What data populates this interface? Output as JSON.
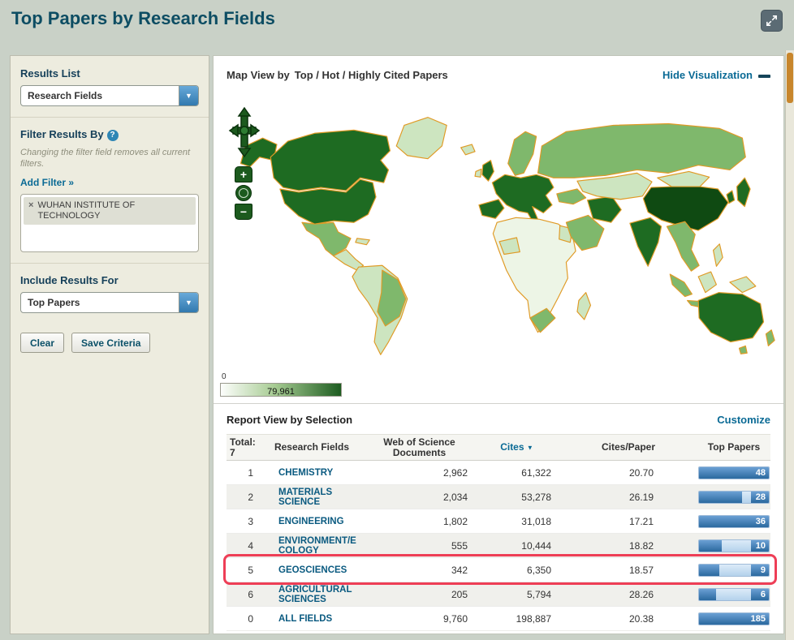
{
  "colors": {
    "accent_blue": "#0a6a95",
    "title_teal": "#0d4d63",
    "highlight_red": "#ee3e56",
    "map_border_orange": "#e09a25",
    "map_greens": [
      "#edf5e6",
      "#cde5c0",
      "#7fb86c",
      "#1e6b22",
      "#0f4a12"
    ],
    "bar_fill_blue": "#2b699f",
    "bar_track_blue": "#b4d2ec",
    "scroll_thumb_orange": "#c8862c"
  },
  "header": {
    "title": "Top Papers by Research Fields"
  },
  "sidebar": {
    "results_list_heading": "Results List",
    "results_list_value": "Research Fields",
    "filter_heading": "Filter Results By",
    "filter_help": "?",
    "filter_note": "Changing the filter field removes all current filters.",
    "add_filter": "Add Filter »",
    "filter_chip_remove": "×",
    "filter_chip_label": "WUHAN INSTITUTE OF TECHNOLOGY",
    "include_heading": "Include Results For",
    "include_value": "Top Papers",
    "clear_button": "Clear",
    "save_button": "Save Criteria"
  },
  "map": {
    "title": "Map View by",
    "title_detail": "Top / Hot / Highly Cited Papers",
    "hide_link": "Hide Visualization",
    "legend_min": "0",
    "legend_max": "79,961",
    "zoom_in": "+",
    "zoom_out": "−"
  },
  "report": {
    "heading": "Report View by Selection",
    "customize": "Customize",
    "total_label": "Total:",
    "total_value": "7",
    "columns": {
      "field": "Research Fields",
      "docs": "Web of Science Documents",
      "cites": "Cites",
      "cites_sort_icon": "▼",
      "cites_per_paper": "Cites/Paper",
      "top_papers": "Top Papers"
    },
    "rows": [
      {
        "rank": "1",
        "field": "CHEMISTRY",
        "docs": "2,962",
        "cites": "61,322",
        "cites_per_paper": "20.70",
        "top_papers": "48",
        "bar_pct": 95
      },
      {
        "rank": "2",
        "field": "MATERIALS\nSCIENCE",
        "docs": "2,034",
        "cites": "53,278",
        "cites_per_paper": "26.19",
        "top_papers": "28",
        "bar_pct": 62
      },
      {
        "rank": "3",
        "field": "ENGINEERING",
        "docs": "1,802",
        "cites": "31,018",
        "cites_per_paper": "17.21",
        "top_papers": "36",
        "bar_pct": 78
      },
      {
        "rank": "4",
        "field": "ENVIRONMENT/E\nCOLOGY",
        "docs": "555",
        "cites": "10,444",
        "cites_per_paper": "18.82",
        "top_papers": "10",
        "bar_pct": 32
      },
      {
        "rank": "5",
        "field": "GEOSCIENCES",
        "docs": "342",
        "cites": "6,350",
        "cites_per_paper": "18.57",
        "top_papers": "9",
        "bar_pct": 29,
        "highlighted": true
      },
      {
        "rank": "6",
        "field": "AGRICULTURAL\nSCIENCES",
        "docs": "205",
        "cites": "5,794",
        "cites_per_paper": "28.26",
        "top_papers": "6",
        "bar_pct": 24
      },
      {
        "rank": "0",
        "field": "ALL FIELDS",
        "docs": "9,760",
        "cites": "198,887",
        "cites_per_paper": "20.38",
        "top_papers": "185",
        "bar_pct": 100
      }
    ]
  },
  "chart_data": [
    {
      "type": "heatmap",
      "subtype": "world-choropleth",
      "title": "Map View by Top / Hot / Highly Cited Papers",
      "scale": {
        "min": 0,
        "max": 79961
      },
      "palette": [
        "#edf5e6",
        "#cde5c0",
        "#7fb86c",
        "#1e6b22",
        "#0f4a12"
      ]
    },
    {
      "type": "bar",
      "orientation": "horizontal",
      "title": "Top Papers",
      "categories": [
        "CHEMISTRY",
        "MATERIALS SCIENCE",
        "ENGINEERING",
        "ENVIRONMENT/ECOLOGY",
        "GEOSCIENCES",
        "AGRICULTURAL SCIENCES",
        "ALL FIELDS"
      ],
      "values": [
        48,
        28,
        36,
        10,
        9,
        6,
        185
      ]
    }
  ]
}
